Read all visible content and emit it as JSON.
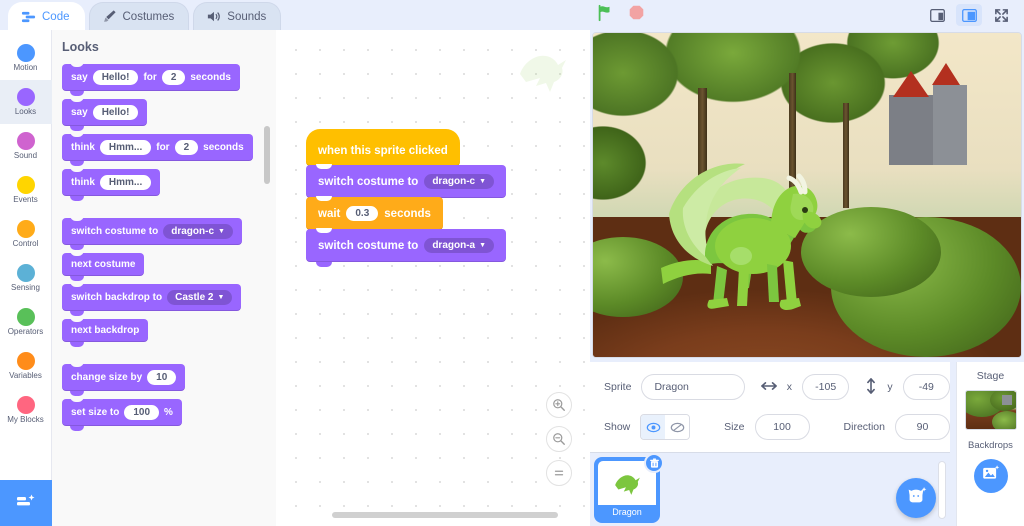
{
  "tabs": [
    {
      "label": "Code",
      "icon": "code-icon",
      "active": true
    },
    {
      "label": "Costumes",
      "icon": "paintbrush-icon",
      "active": false
    },
    {
      "label": "Sounds",
      "icon": "speaker-icon",
      "active": false
    }
  ],
  "controls": {
    "green_flag": "green-flag-icon",
    "stop": "stop-icon",
    "small_stage": "small-stage-icon",
    "large_stage": "large-stage-icon",
    "fullscreen": "fullscreen-icon"
  },
  "categories": [
    {
      "label": "Motion",
      "color": "#4c97ff",
      "selected": false
    },
    {
      "label": "Looks",
      "color": "#9966ff",
      "selected": true
    },
    {
      "label": "Sound",
      "color": "#cf63cf",
      "selected": false
    },
    {
      "label": "Events",
      "color": "#ffd500",
      "selected": false
    },
    {
      "label": "Control",
      "color": "#ffab19",
      "selected": false
    },
    {
      "label": "Sensing",
      "color": "#5cb1d6",
      "selected": false
    },
    {
      "label": "Operators",
      "color": "#59c059",
      "selected": false
    },
    {
      "label": "Variables",
      "color": "#ff8c1a",
      "selected": false
    },
    {
      "label": "My Blocks",
      "color": "#ff6680",
      "selected": false
    }
  ],
  "extension_button": "add-extension-icon",
  "palette": {
    "title": "Looks",
    "blocks": [
      {
        "parts": [
          {
            "t": "text",
            "v": "say"
          },
          {
            "t": "oval",
            "v": "Hello!"
          },
          {
            "t": "text",
            "v": "for"
          },
          {
            "t": "oval",
            "v": "2"
          },
          {
            "t": "text",
            "v": "seconds"
          }
        ]
      },
      {
        "parts": [
          {
            "t": "text",
            "v": "say"
          },
          {
            "t": "oval",
            "v": "Hello!"
          }
        ]
      },
      {
        "parts": [
          {
            "t": "text",
            "v": "think"
          },
          {
            "t": "oval",
            "v": "Hmm..."
          },
          {
            "t": "text",
            "v": "for"
          },
          {
            "t": "oval",
            "v": "2"
          },
          {
            "t": "text",
            "v": "seconds"
          }
        ]
      },
      {
        "parts": [
          {
            "t": "text",
            "v": "think"
          },
          {
            "t": "oval",
            "v": "Hmm..."
          }
        ]
      },
      {
        "parts": [
          {
            "t": "text",
            "v": "switch costume to"
          },
          {
            "t": "drop",
            "v": "dragon-c"
          }
        ]
      },
      {
        "parts": [
          {
            "t": "text",
            "v": "next costume"
          }
        ]
      },
      {
        "parts": [
          {
            "t": "text",
            "v": "switch backdrop to"
          },
          {
            "t": "drop",
            "v": "Castle 2"
          }
        ]
      },
      {
        "parts": [
          {
            "t": "text",
            "v": "next backdrop"
          }
        ]
      },
      {
        "parts": [
          {
            "t": "text",
            "v": "change size by"
          },
          {
            "t": "oval",
            "v": "10"
          }
        ]
      },
      {
        "parts": [
          {
            "t": "text",
            "v": "set size to"
          },
          {
            "t": "oval",
            "v": "100"
          },
          {
            "t": "text",
            "v": "%"
          }
        ]
      }
    ]
  },
  "script": [
    {
      "kind": "hat",
      "cat": "event",
      "parts": [
        {
          "t": "text",
          "v": "when this sprite clicked"
        }
      ]
    },
    {
      "kind": "stack",
      "cat": "looks",
      "parts": [
        {
          "t": "text",
          "v": "switch costume to"
        },
        {
          "t": "drop",
          "v": "dragon-c"
        }
      ]
    },
    {
      "kind": "stack",
      "cat": "control",
      "parts": [
        {
          "t": "text",
          "v": "wait"
        },
        {
          "t": "oval",
          "v": "0.3"
        },
        {
          "t": "text",
          "v": "seconds"
        }
      ]
    },
    {
      "kind": "stack",
      "cat": "looks",
      "parts": [
        {
          "t": "text",
          "v": "switch costume to"
        },
        {
          "t": "drop",
          "v": "dragon-a"
        }
      ]
    }
  ],
  "workspace": {
    "zoom_in": "zoom-in-icon",
    "zoom_out": "zoom-out-icon",
    "zoom_reset": "zoom-reset-icon",
    "watermark": "dragon-watermark-icon"
  },
  "sprite_info": {
    "sprite_label": "Sprite",
    "sprite_name": "Dragon",
    "x_label": "x",
    "x_value": "-105",
    "y_label": "y",
    "y_value": "-49",
    "show_label": "Show",
    "show_visible_icon": "eye-icon",
    "show_hidden_icon": "eye-slash-icon",
    "size_label": "Size",
    "size_value": "100",
    "direction_label": "Direction",
    "direction_value": "90"
  },
  "sprite_list": {
    "items": [
      {
        "name": "Dragon",
        "selected": true,
        "delete_icon": "trash-icon"
      }
    ],
    "add_sprite_icon": "add-sprite-icon"
  },
  "stage_selector": {
    "header": "Stage",
    "backdrops_label": "Backdrops",
    "add_backdrop_icon": "add-backdrop-icon"
  }
}
